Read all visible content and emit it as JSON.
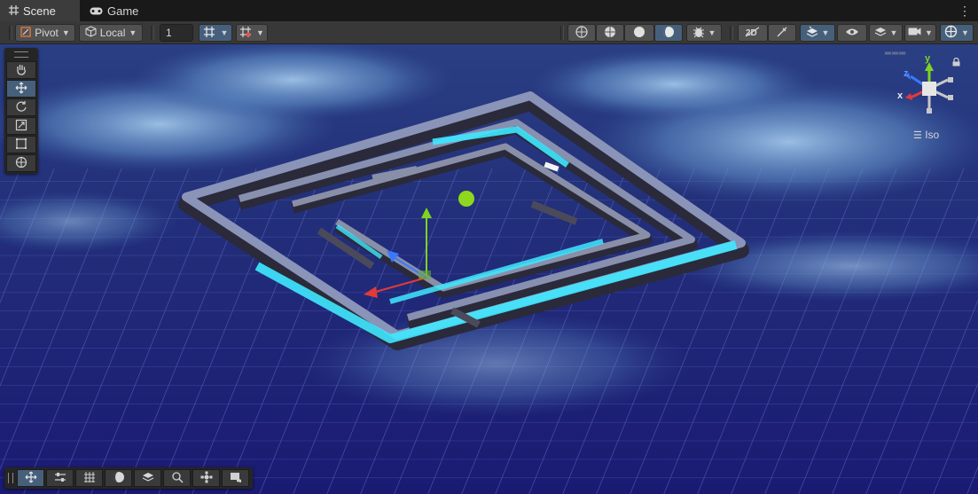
{
  "tabs": {
    "scene_label": "Scene",
    "game_label": "Game",
    "menu_label": "⋮"
  },
  "toolbar": {
    "pivot_label": "Pivot",
    "local_label": "Local",
    "grid_snap_value": "1",
    "dropdown_caret": "▼"
  },
  "tools": [
    "hand-tool",
    "move-tool",
    "rotate-tool",
    "scale-tool",
    "rect-tool",
    "transform-tool"
  ],
  "gizmo": {
    "projection_label": "Iso",
    "axis_x": "x",
    "axis_y": "y",
    "axis_z": "z"
  },
  "overlay_bottom": [
    "move-overlay",
    "sliders-overlay",
    "grid-overlay",
    "shading-overlay",
    "layers-overlay",
    "search-overlay",
    "navigation-overlay",
    "camera-overlay"
  ],
  "colors": {
    "accent": "#46607c",
    "axis_x": "#e03a3a",
    "axis_y": "#7ed321",
    "axis_z": "#3a78ff",
    "glow_wall": "#3fe8ff"
  }
}
